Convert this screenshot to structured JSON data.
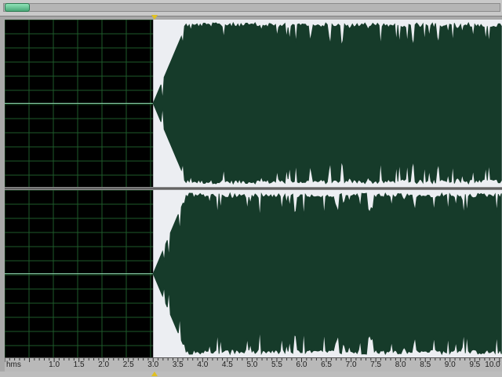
{
  "editor": {
    "ruler_unit": "hms",
    "ruler_labels": [
      "1.0",
      "1.5",
      "2.0",
      "2.5",
      "3.0",
      "3.5",
      "4.0",
      "4.5",
      "5.0",
      "5.5",
      "6.0",
      "6.5",
      "7.0",
      "7.5",
      "8.0",
      "8.5",
      "9.0",
      "9.5",
      "10.0"
    ],
    "ruler_values": [
      1.0,
      1.5,
      2.0,
      2.5,
      3.0,
      3.5,
      4.0,
      4.5,
      5.0,
      5.5,
      6.0,
      6.5,
      7.0,
      7.5,
      8.0,
      8.5,
      9.0,
      9.5,
      10.0
    ],
    "view_start_seconds": 0.0,
    "view_end_seconds": 10.05,
    "selection_start_seconds": 3.0,
    "playhead_seconds": 3.0,
    "channels": [
      "left",
      "right"
    ]
  },
  "colors": {
    "background": "#000000",
    "grid": "#1e5a2a",
    "waveform": "#163b2a",
    "selection": "#eceef2",
    "center_line": "#8fd6b0",
    "ruler": "#b9b9b9",
    "playhead_marker": "#e0c020",
    "scroll_thumb": "#6cc79a"
  },
  "icons": {
    "playhead": "triangle-marker-icon",
    "scroll_thumb": "scroll-thumb"
  }
}
